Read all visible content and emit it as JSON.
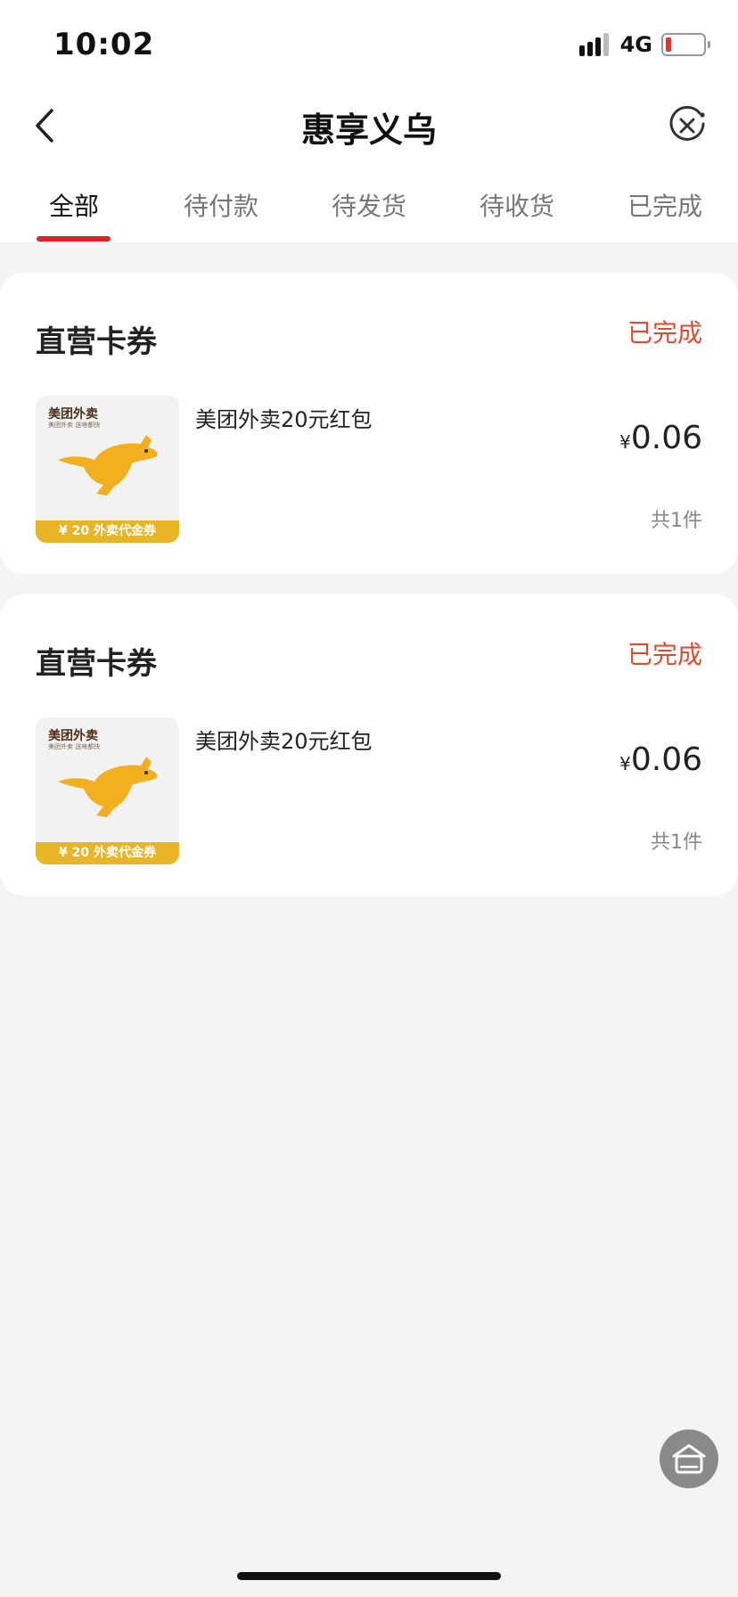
{
  "status_bar": {
    "time": "10:02",
    "network": "4G"
  },
  "nav": {
    "title": "惠享义乌"
  },
  "tabs": [
    {
      "label": "全部",
      "active": true
    },
    {
      "label": "待付款",
      "active": false
    },
    {
      "label": "待发货",
      "active": false
    },
    {
      "label": "待收货",
      "active": false
    },
    {
      "label": "已完成",
      "active": false
    }
  ],
  "orders": [
    {
      "shop": "直营卡券",
      "status": "已完成",
      "item": {
        "name": "美团外卖20元红包",
        "currency": "¥",
        "price": "0.06",
        "qty": "共1件",
        "thumb": {
          "brand": "美团外卖",
          "tagline": "美团外卖 送啥都快",
          "band": "¥ 20 外卖代金券"
        }
      }
    },
    {
      "shop": "直营卡券",
      "status": "已完成",
      "item": {
        "name": "美团外卖20元红包",
        "currency": "¥",
        "price": "0.06",
        "qty": "共1件",
        "thumb": {
          "brand": "美团外卖",
          "tagline": "美团外卖 送啥都快",
          "band": "¥ 20 外卖代金券"
        }
      }
    }
  ],
  "colors": {
    "accent_red": "#e0232b",
    "status_red": "#e04a2f",
    "voucher_gold": "#e8b526"
  },
  "icons": {
    "back": "chevron-left-icon",
    "close": "close-circle-icon",
    "float": "home-icon"
  }
}
